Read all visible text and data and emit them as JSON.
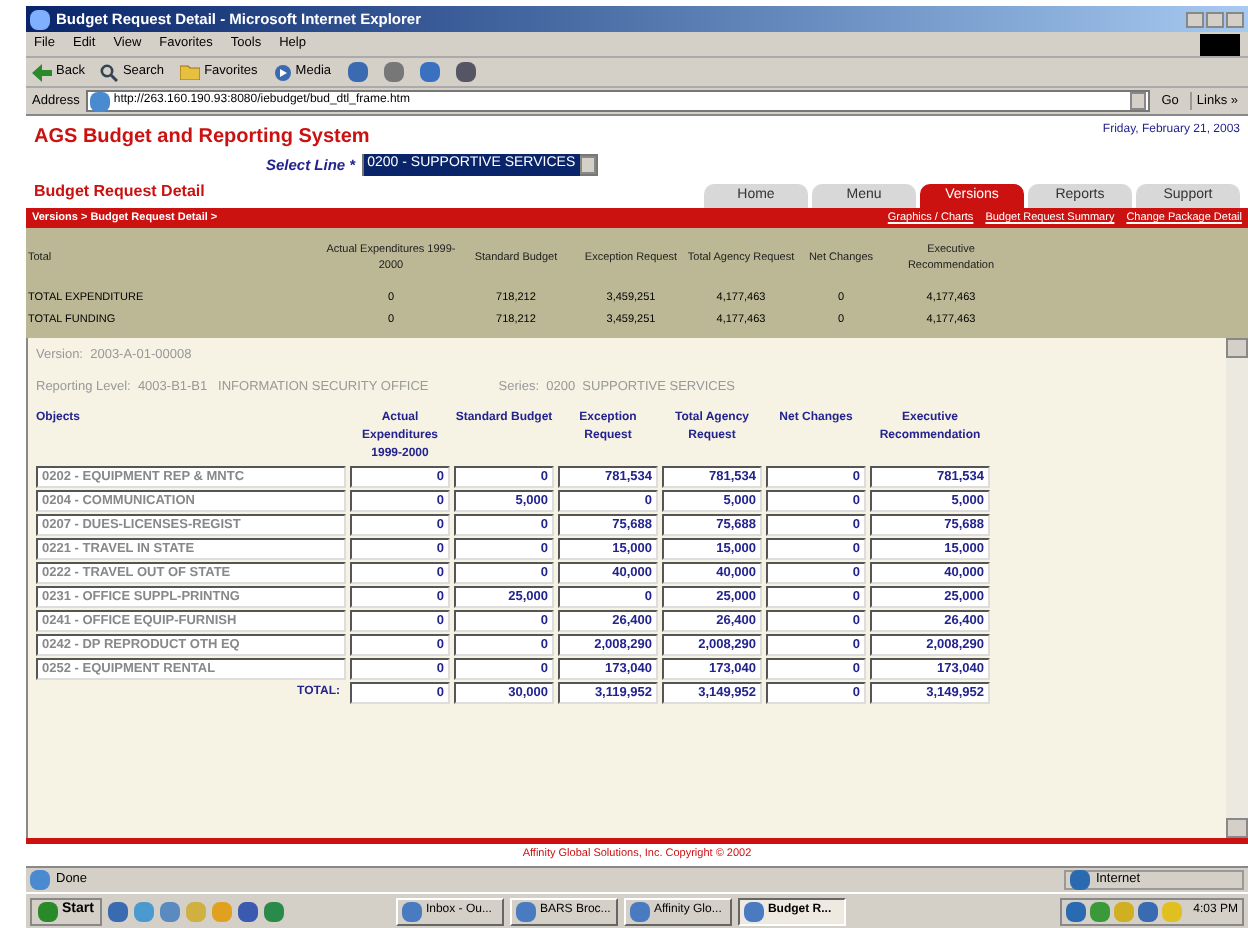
{
  "window": {
    "title": "Budget Request Detail - Microsoft Internet Explorer"
  },
  "menu": [
    "File",
    "Edit",
    "View",
    "Favorites",
    "Tools",
    "Help"
  ],
  "toolbar": [
    {
      "kind": "back",
      "label": "Back"
    },
    {
      "kind": "search",
      "label": "Search"
    },
    {
      "kind": "favorites",
      "label": "Favorites"
    },
    {
      "kind": "media",
      "label": "Media"
    }
  ],
  "address": {
    "label": "Address",
    "value": "http://263.160.190.93:8080/iebudget/bud_dtl_frame.htm",
    "go": "Go",
    "links": "Links »"
  },
  "app": {
    "title": "AGS Budget and Reporting System",
    "date": "Friday, February 21, 2003",
    "select_label": "Select Line *",
    "select_value": "0200 - SUPPORTIVE SERVICES",
    "page_title": "Budget Request Detail"
  },
  "tabs": [
    {
      "label": "Home",
      "selected": false
    },
    {
      "label": "Menu",
      "selected": false
    },
    {
      "label": "Versions",
      "selected": true
    },
    {
      "label": "Reports",
      "selected": false
    },
    {
      "label": "Support",
      "selected": false
    }
  ],
  "breadcrumb": "Versions > Budget Request Detail >",
  "links": [
    "Graphics / Charts",
    "Budget Request Summary",
    "Change Package Detail"
  ],
  "summary": {
    "columns": [
      "Total",
      "Actual Expenditures 1999-2000",
      "Standard Budget",
      "Exception Request",
      "Total Agency Request",
      "Net Changes",
      "Executive Recommendation"
    ],
    "rows": [
      [
        "TOTAL EXPENDITURE",
        "0",
        "718,212",
        "3,459,251",
        "4,177,463",
        "0",
        "4,177,463"
      ],
      [
        "TOTAL FUNDING",
        "0",
        "718,212",
        "3,459,251",
        "4,177,463",
        "0",
        "4,177,463"
      ]
    ]
  },
  "version": "Version:  2003-A-01-00008",
  "reporting_level": "Reporting Level:  4003-B1-B1   INFORMATION SECURITY OFFICE",
  "series": "Series:  0200  SUPPORTIVE SERVICES",
  "table": {
    "columns": [
      "Objects",
      "Actual Expenditures 1999-2000",
      "Standard Budget",
      "Exception Request",
      "Total Agency Request",
      "Net Changes",
      "Executive Recommendation"
    ],
    "rows": [
      [
        "0202 - EQUIPMENT REP & MNTC",
        "0",
        "0",
        "781,534",
        "781,534",
        "0",
        "781,534"
      ],
      [
        "0204 - COMMUNICATION",
        "0",
        "5,000",
        "0",
        "5,000",
        "0",
        "5,000"
      ],
      [
        "0207 - DUES-LICENSES-REGIST",
        "0",
        "0",
        "75,688",
        "75,688",
        "0",
        "75,688"
      ],
      [
        "0221 - TRAVEL IN STATE",
        "0",
        "0",
        "15,000",
        "15,000",
        "0",
        "15,000"
      ],
      [
        "0222 - TRAVEL OUT OF STATE",
        "0",
        "0",
        "40,000",
        "40,000",
        "0",
        "40,000"
      ],
      [
        "0231 - OFFICE SUPPL-PRINTNG",
        "0",
        "25,000",
        "0",
        "25,000",
        "0",
        "25,000"
      ],
      [
        "0241 - OFFICE EQUIP-FURNISH",
        "0",
        "0",
        "26,400",
        "26,400",
        "0",
        "26,400"
      ],
      [
        "0242 - DP REPRODUCT OTH EQ",
        "0",
        "0",
        "2,008,290",
        "2,008,290",
        "0",
        "2,008,290"
      ],
      [
        "0252 - EQUIPMENT RENTAL",
        "0",
        "0",
        "173,040",
        "173,040",
        "0",
        "173,040"
      ]
    ],
    "total_label": "TOTAL:",
    "totals": [
      "0",
      "30,000",
      "3,119,952",
      "3,149,952",
      "0",
      "3,149,952"
    ]
  },
  "footer": "Affinity Global Solutions, Inc.  Copyright © 2002",
  "status": {
    "text": "Done",
    "zone": "Internet"
  },
  "taskbar": {
    "start": "Start",
    "tasks": [
      {
        "label": "Inbox - Ou...",
        "selected": false
      },
      {
        "label": "BARS Broc...",
        "selected": false
      },
      {
        "label": "Affinity Glo...",
        "selected": false
      },
      {
        "label": "Budget R...",
        "selected": true
      }
    ],
    "clock": "4:03 PM"
  }
}
